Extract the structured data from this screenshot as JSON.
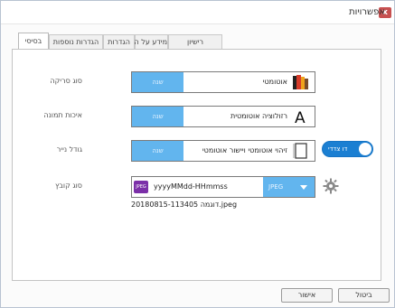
{
  "window": {
    "title": "אפשרויות",
    "close_label": "x"
  },
  "tabs": [
    {
      "label": "בסיסי",
      "active": true
    },
    {
      "label": "הגדרות נוספות",
      "active": false
    },
    {
      "label": "הגדרות",
      "active": false
    },
    {
      "label": "מידע על המוצר",
      "active": false
    },
    {
      "label": "רישיון",
      "active": false
    }
  ],
  "rows": {
    "scan_type": {
      "label": "סוג סריקה",
      "value": "אוטומטי",
      "change_label": "שנה",
      "icon": "color-book-icon"
    },
    "image_quality": {
      "label": "איכות תמונה",
      "value": "רזולוציה אוטומטית",
      "change_label": "שנה",
      "icon": "letter-a-icon"
    },
    "paper_size": {
      "label": "גודל נייר",
      "value": "זיהוי אוטומטי ויישור אוטומטי",
      "change_label": "שנה",
      "icon": "page-outline-icon"
    },
    "file_type": {
      "label": "סוג קובץ",
      "value": "yyyyMMdd-HHmmss",
      "format": "JPEG",
      "badge": "JPEG",
      "icon": "gear-icon"
    }
  },
  "toggle": {
    "label": "דו צדדי",
    "on": true
  },
  "filename_preview": "20180815-113405 דוגמה.jpeg",
  "buttons": {
    "ok": "אישור",
    "cancel": "ביטול"
  }
}
